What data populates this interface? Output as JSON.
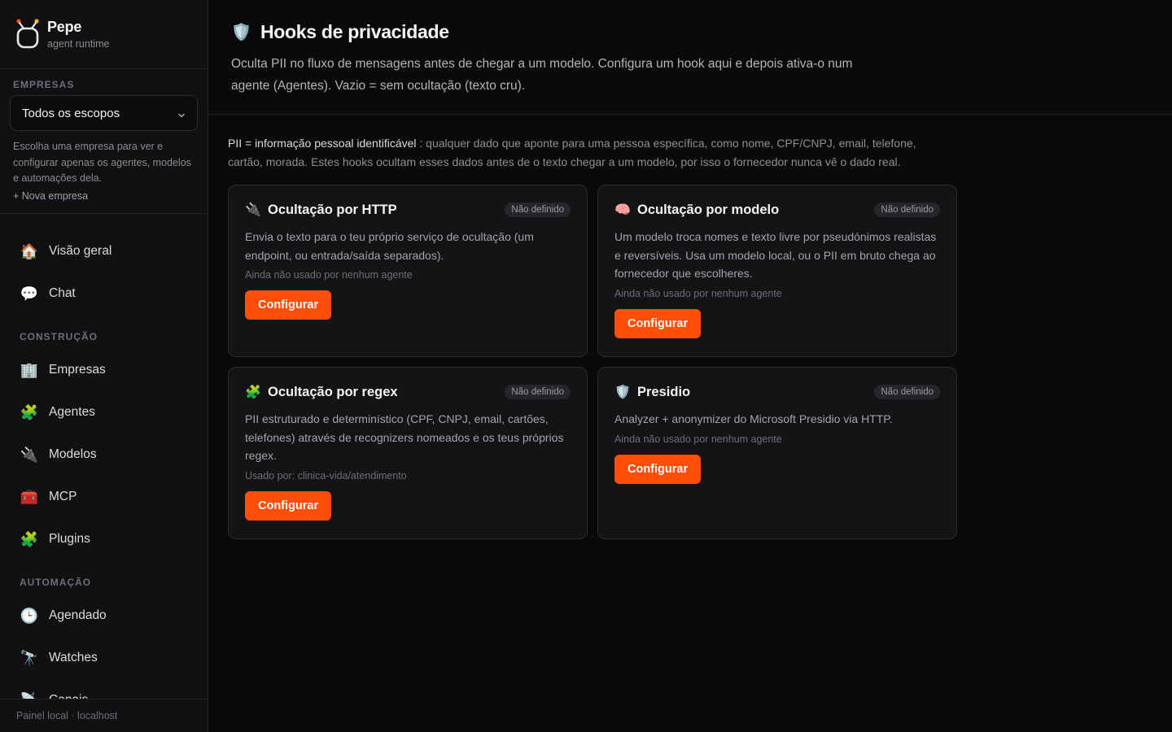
{
  "brand": {
    "name": "Pepe",
    "subtitle": "agent runtime"
  },
  "org": {
    "label": "EMPRESAS",
    "selected": "Todos os escopos",
    "help": "Escolha uma empresa para ver e configurar apenas os agentes, modelos e automações dela.",
    "new_link": "+ Nova empresa"
  },
  "nav": {
    "top": [
      {
        "icon": "🏠",
        "label": "Visão geral"
      },
      {
        "icon": "💬",
        "label": "Chat"
      }
    ],
    "construcao_label": "CONSTRUÇÃO",
    "construcao": [
      {
        "icon": "🏢",
        "label": "Empresas"
      },
      {
        "icon": "🧩",
        "label": "Agentes"
      },
      {
        "icon": "🔌",
        "label": "Modelos"
      },
      {
        "icon": "🧰",
        "label": "MCP"
      },
      {
        "icon": "🧩",
        "label": "Plugins"
      }
    ],
    "automacao_label": "AUTOMAÇÃO",
    "automacao": [
      {
        "icon": "🕒",
        "label": "Agendado"
      },
      {
        "icon": "🔭",
        "label": "Watches"
      },
      {
        "icon": "📡",
        "label": "Canais"
      }
    ]
  },
  "footer": {
    "text": "Painel local · localhost"
  },
  "page": {
    "icon": "🛡️",
    "title": "Hooks de privacidade",
    "description": "Oculta PII no fluxo de mensagens antes de chegar a um modelo. Configura um hook aqui e depois ativa-o num agente (Agentes). Vazio = sem ocultação (texto cru).",
    "intro_strong": "PII = informação pessoal identificável",
    "intro_rest": " : qualquer dado que aponte para uma pessoa específica, como nome, CPF/CNPJ, email, telefone, cartão, morada. Estes hooks ocultam esses dados antes de o texto chegar a um modelo, por isso o fornecedor nunca vê o dado real."
  },
  "cards": [
    {
      "icon": "🔌",
      "title": "Ocultação por HTTP",
      "badge": "Não definido",
      "description": "Envia o texto para o teu próprio serviço de ocultação (um endpoint, ou entrada/saída separados).",
      "usage": "Ainda não usado por nenhum agente",
      "button": "Configurar"
    },
    {
      "icon": "🧠",
      "title": "Ocultação por modelo",
      "badge": "Não definido",
      "description": "Um modelo troca nomes e texto livre por pseudónimos realistas e reversíveis. Usa um modelo local, ou o PII em bruto chega ao fornecedor que escolheres.",
      "usage": "Ainda não usado por nenhum agente",
      "button": "Configurar"
    },
    {
      "icon": "🧩",
      "title": "Ocultação por regex",
      "badge": "Não definido",
      "description": "PII estruturado e determinístico (CPF, CNPJ, email, cartões, telefones) através de recognizers nomeados e os teus próprios regex.",
      "usage": "Usado por: clinica-vida/atendimento",
      "button": "Configurar"
    },
    {
      "icon": "🛡️",
      "title": "Presidio",
      "badge": "Não definido",
      "description": "Analyzer + anonymizer do Microsoft Presidio via HTTP.",
      "usage": "Ainda não usado por nenhum agente",
      "button": "Configurar"
    }
  ]
}
